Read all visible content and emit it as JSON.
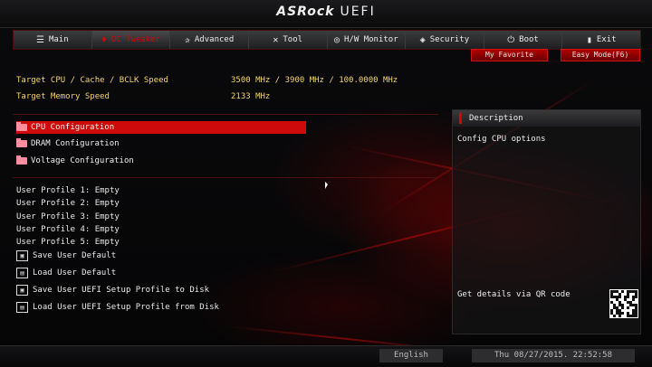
{
  "brand": {
    "logo": "ASRock",
    "suffix": "UEFI"
  },
  "tabs": [
    {
      "label": "Main",
      "icon": "list-icon",
      "glyph": "☰",
      "active": false
    },
    {
      "label": "OC Tweaker",
      "icon": "flame-icon",
      "glyph": "♦",
      "active": true
    },
    {
      "label": "Advanced",
      "icon": "star-icon",
      "glyph": "✰",
      "active": false
    },
    {
      "label": "Tool",
      "icon": "tools-icon",
      "glyph": "✕",
      "active": false
    },
    {
      "label": "H/W Monitor",
      "icon": "monitor-icon",
      "glyph": "◎",
      "active": false
    },
    {
      "label": "Security",
      "icon": "shield-icon",
      "glyph": "◈",
      "active": false
    },
    {
      "label": "Boot",
      "icon": "power-icon",
      "glyph": "⏻",
      "active": false
    },
    {
      "label": "Exit",
      "icon": "exit-icon",
      "glyph": "▮",
      "active": false
    }
  ],
  "subbuttons": {
    "favorite": "My Favorite",
    "easy_mode": "Easy Mode(F6)"
  },
  "info": {
    "cpu_label": "Target CPU / Cache / BCLK Speed",
    "cpu_value": "3500 MHz / 3900 MHz / 100.0000 MHz",
    "mem_label": "Target Memory Speed",
    "mem_value": "2133 MHz"
  },
  "menu": [
    {
      "label": "CPU Configuration",
      "selected": true
    },
    {
      "label": "DRAM Configuration",
      "selected": false
    },
    {
      "label": "Voltage Configuration",
      "selected": false
    }
  ],
  "profiles": [
    "User Profile 1: Empty",
    "User Profile 2: Empty",
    "User Profile 3: Empty",
    "User Profile 4: Empty",
    "User Profile 5: Empty"
  ],
  "actions": [
    {
      "label": "Save User Default",
      "icon": "save-icon"
    },
    {
      "label": "Load User Default",
      "icon": "load-icon"
    },
    {
      "label": "Save User UEFI Setup Profile to Disk",
      "icon": "disk-save-icon"
    },
    {
      "label": "Load User UEFI Setup Profile from Disk",
      "icon": "disk-load-icon"
    }
  ],
  "description": {
    "title": "Description",
    "text": "Config CPU options",
    "qr_label": "Get details via QR code"
  },
  "footer": {
    "language": "English",
    "datetime": "Thu 08/27/2015. 22:52:58"
  },
  "colors": {
    "accent": "#cf0a0a",
    "info_text": "#f4d36a"
  }
}
